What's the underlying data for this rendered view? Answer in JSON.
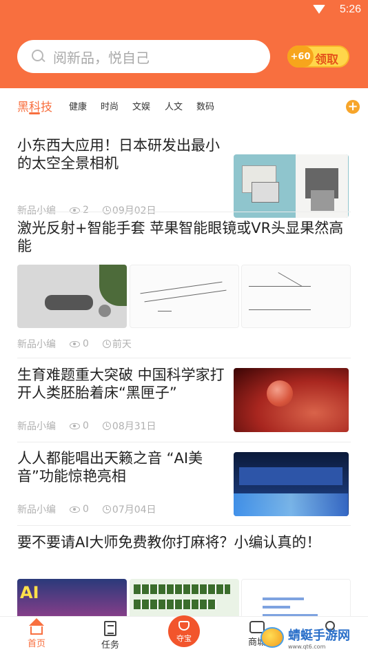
{
  "status_bar": {
    "time": "5:26"
  },
  "header": {
    "search_placeholder": "阅新品，悦自己",
    "reward_coin": "+60",
    "reward_label": "领取"
  },
  "tabs": [
    "黑科技",
    "健康",
    "时尚",
    "文娱",
    "人文",
    "数码"
  ],
  "feed": [
    {
      "title": "小东西大应用！日本研发出最小的太空全景相机",
      "author": "新品小编",
      "views": "2",
      "date": "09月02日"
    },
    {
      "title": "激光反射+智能手套 苹果智能眼镜或VR头显果然高能",
      "author": "新品小编",
      "views": "0",
      "date": "前天"
    },
    {
      "title": "生育难题重大突破 中国科学家打开人类胚胎着床“黑匣子”",
      "author": "新品小编",
      "views": "0",
      "date": "08月31日"
    },
    {
      "title": "人人都能唱出天籁之音 “AI美音”功能惊艳亮相",
      "author": "新品小编",
      "views": "0",
      "date": "07月04日"
    },
    {
      "title": "要不要请AI大师免费教你打麻将？小编认真的！"
    }
  ],
  "bottom_nav": {
    "home": "首页",
    "tasks": "任务",
    "treasure": "夺宝",
    "mall": "商城"
  },
  "watermark": {
    "main": "蜻蜓手游网",
    "sub": "www.qt6.com"
  },
  "colors": {
    "accent": "#f86f3f",
    "coin": "#ffd64a"
  }
}
